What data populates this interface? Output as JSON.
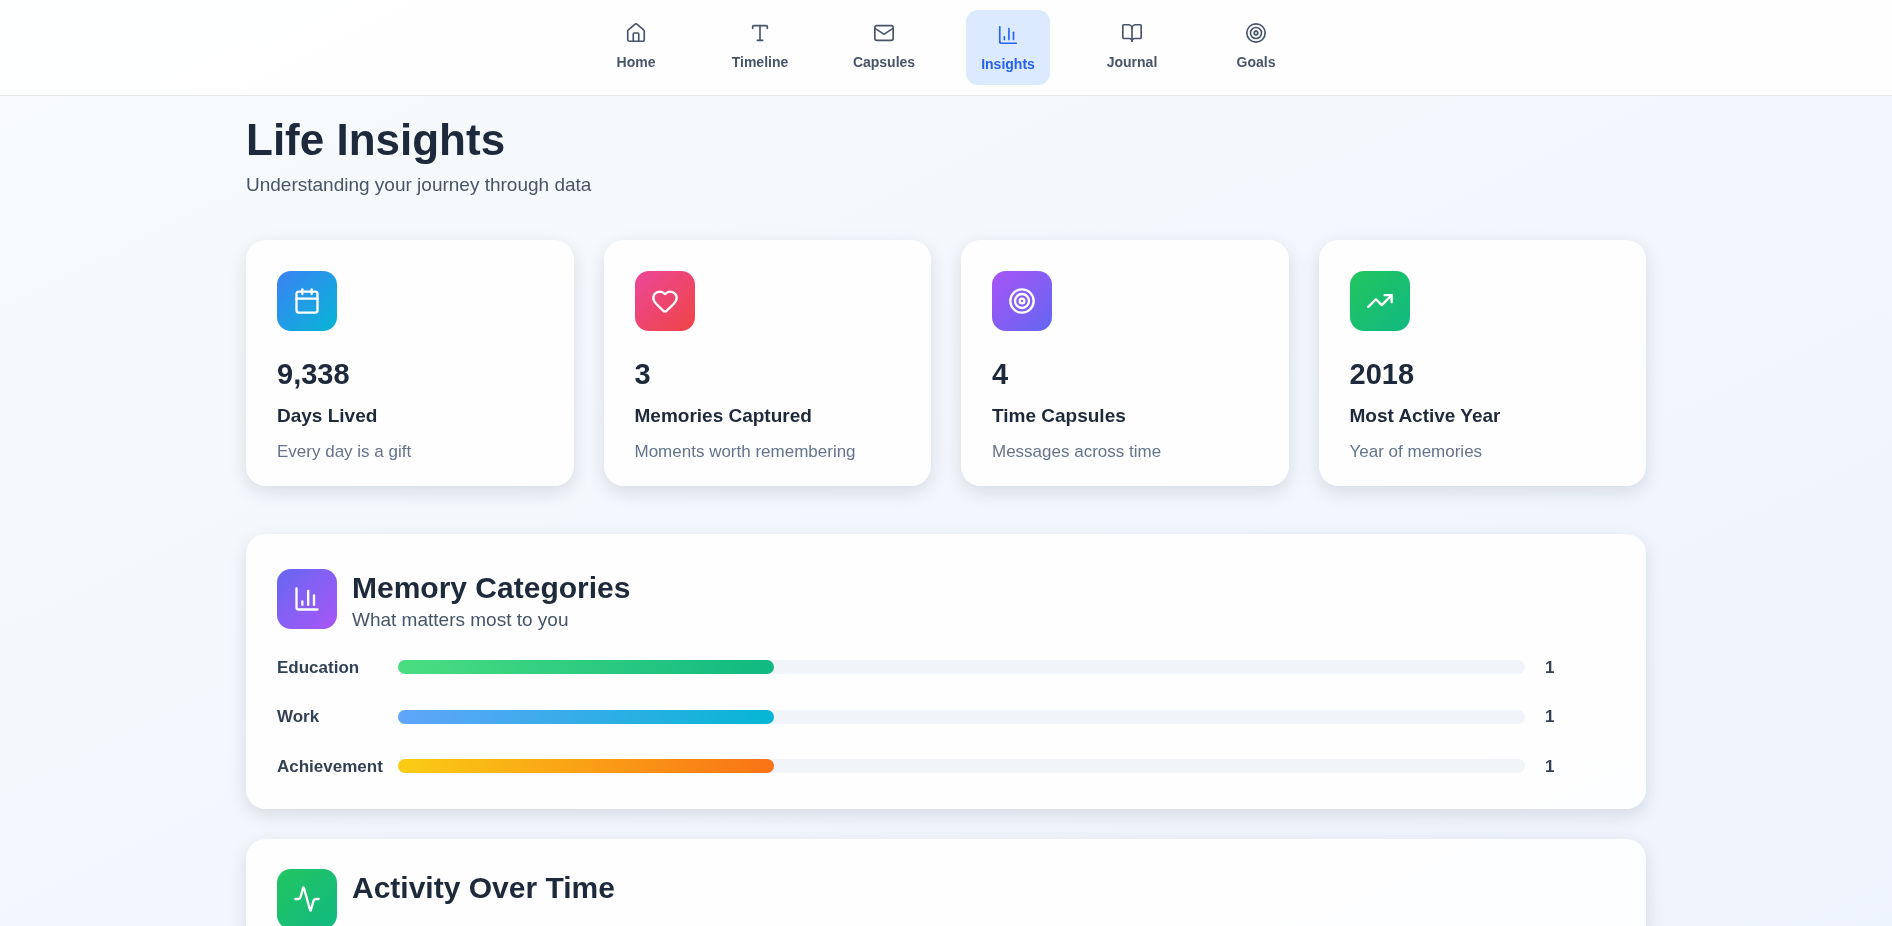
{
  "nav": [
    {
      "label": "Home",
      "selected": false
    },
    {
      "label": "Timeline",
      "selected": false
    },
    {
      "label": "Capsules",
      "selected": false
    },
    {
      "label": "Insights",
      "selected": true
    },
    {
      "label": "Journal",
      "selected": false
    },
    {
      "label": "Goals",
      "selected": false
    }
  ],
  "header": {
    "title": "Life Insights",
    "subtitle": "Understanding your journey through data"
  },
  "stats": [
    {
      "value": "9,338",
      "label": "Days Lived",
      "note": "Every day is a gift"
    },
    {
      "value": "3",
      "label": "Memories Captured",
      "note": "Moments worth remembering"
    },
    {
      "value": "4",
      "label": "Time Capsules",
      "note": "Messages across time"
    },
    {
      "value": "2018",
      "label": "Most Active Year",
      "note": "Year of memories"
    }
  ],
  "categories": {
    "title": "Memory Categories",
    "subtitle": "What matters most to you",
    "rows": [
      {
        "name": "Education",
        "level": 0.334,
        "count": "1"
      },
      {
        "name": "Work",
        "level": 0.334,
        "count": "1"
      },
      {
        "name": "Achievement",
        "level": 0.334,
        "count": "1"
      }
    ]
  },
  "activity": {
    "title": "Activity Over Time"
  }
}
